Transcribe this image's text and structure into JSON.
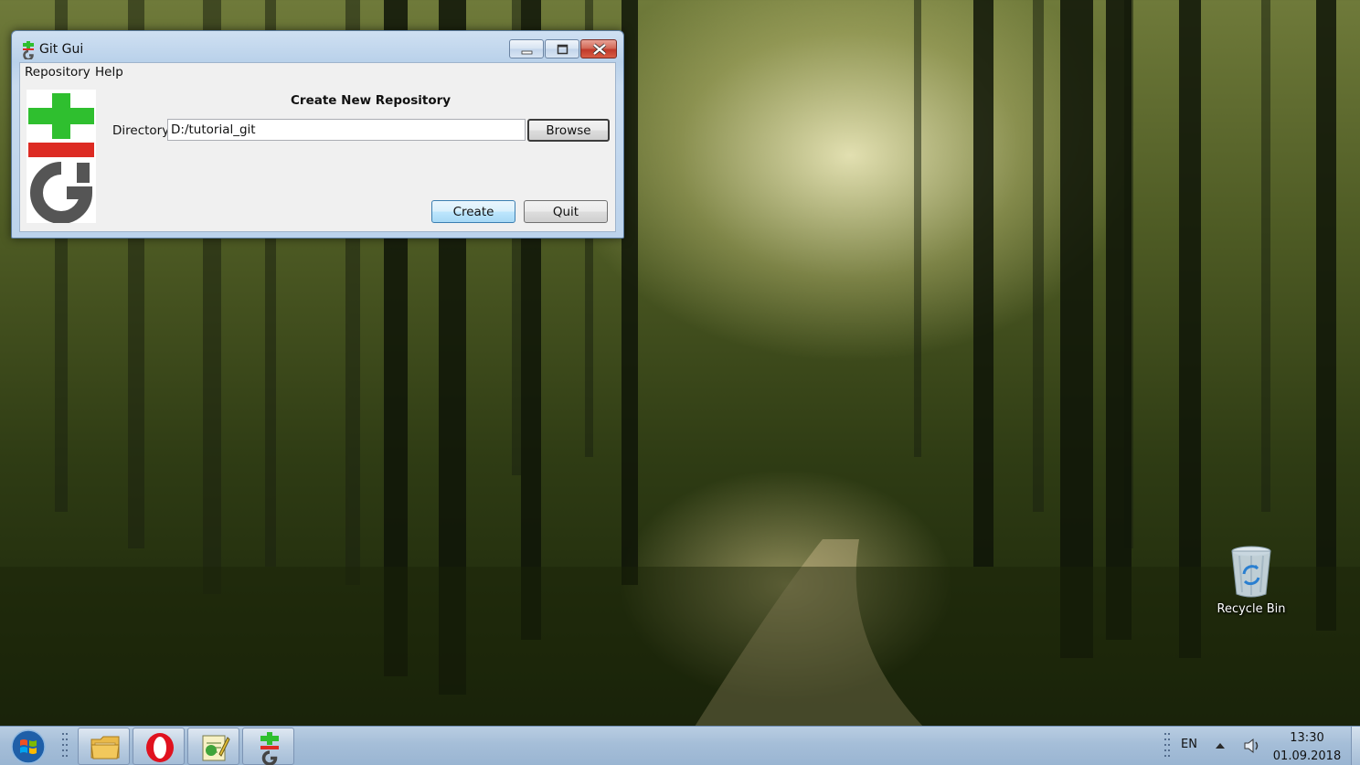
{
  "window": {
    "title": "Git Gui",
    "menu": [
      "Repository",
      "Help"
    ],
    "heading": "Create New Repository",
    "directory_label": "Directory:",
    "directory_value": "D:/tutorial_git",
    "browse_label": "Browse",
    "create_label": "Create",
    "quit_label": "Quit"
  },
  "desktop": {
    "recycle_bin_label": "Recycle Bin"
  },
  "taskbar": {
    "pinned_icons": [
      "windows-start-icon",
      "file-explorer-icon",
      "opera-icon",
      "notepad-icon",
      "git-gui-icon"
    ],
    "language": "EN",
    "time": "13:30",
    "date": "01.09.2018"
  },
  "colors": {
    "git_green": "#2fbf2f",
    "git_red": "#dd2b23",
    "git_gray": "#555555",
    "taskbar": "#a5bed8"
  }
}
